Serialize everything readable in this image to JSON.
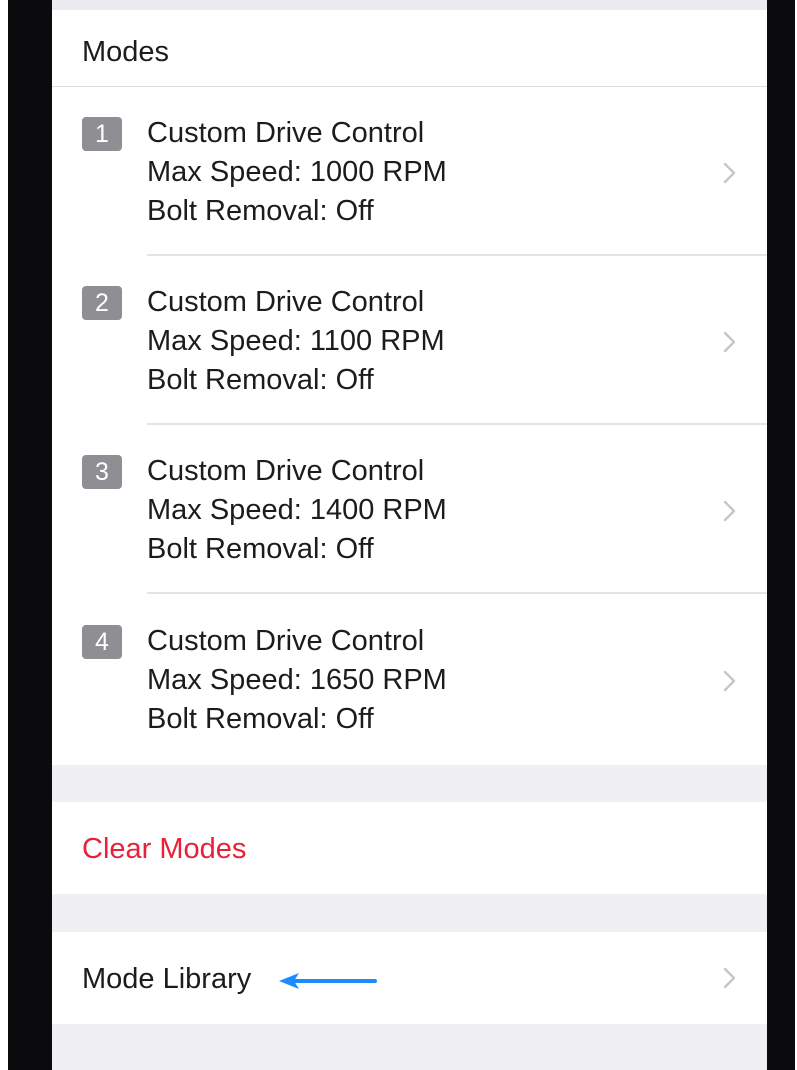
{
  "header": {
    "title": "Modes"
  },
  "modes": [
    {
      "number": "1",
      "name": "Custom Drive Control",
      "speed": "Max Speed: 1000 RPM",
      "bolt": "Bolt Removal: Off"
    },
    {
      "number": "2",
      "name": "Custom Drive Control",
      "speed": "Max Speed: 1100 RPM",
      "bolt": "Bolt Removal: Off"
    },
    {
      "number": "3",
      "name": "Custom Drive Control",
      "speed": "Max Speed: 1400 RPM",
      "bolt": "Bolt Removal: Off"
    },
    {
      "number": "4",
      "name": "Custom Drive Control",
      "speed": "Max Speed: 1650 RPM",
      "bolt": "Bolt Removal: Off"
    }
  ],
  "actions": {
    "clear_label": "Clear Modes"
  },
  "library": {
    "label": "Mode Library"
  },
  "icons": {
    "row_chevron": "chevron-right-icon",
    "annotation": "arrow-left-icon"
  },
  "colors": {
    "destructive": "#e8203a",
    "badge": "#8e8e93",
    "annotation_arrow": "#1a8cff",
    "group_background": "#efeff4"
  }
}
